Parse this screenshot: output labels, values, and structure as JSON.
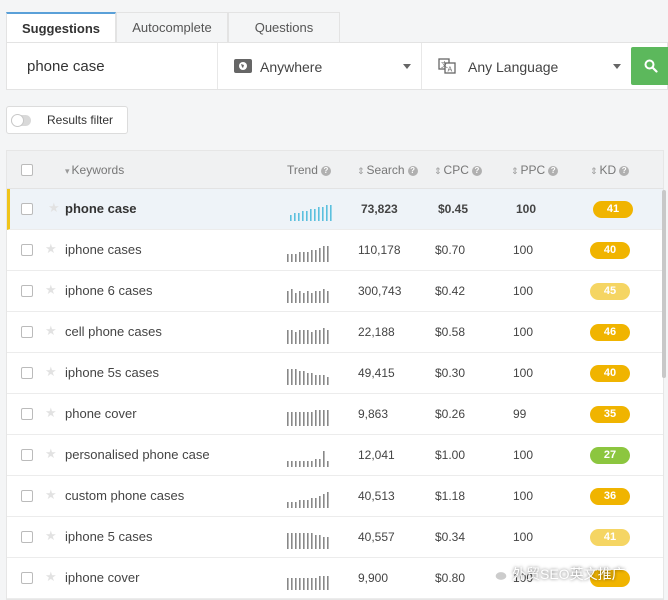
{
  "tabs": [
    {
      "label": "Suggestions",
      "active": true
    },
    {
      "label": "Autocomplete",
      "active": false
    },
    {
      "label": "Questions",
      "active": false
    }
  ],
  "search": {
    "value": "phone case",
    "location": "Anywhere",
    "language": "Any Language",
    "button_icon": "search-icon"
  },
  "filter": {
    "label": "Results filter",
    "enabled": false
  },
  "table": {
    "headers": {
      "keywords": "Keywords",
      "trend": "Trend",
      "search": "Search",
      "cpc": "CPC",
      "ppc": "PPC",
      "kd": "KD"
    },
    "rows": [
      {
        "keyword": "phone case",
        "search": "73,823",
        "cpc": "$0.45",
        "ppc": "100",
        "kd": "41",
        "kd_color": "#f0b400",
        "trend": [
          3,
          4,
          4,
          5,
          5,
          6,
          6,
          7,
          7,
          8,
          8
        ],
        "trend_color": "#5bc0de"
      },
      {
        "keyword": "iphone cases",
        "search": "110,178",
        "cpc": "$0.70",
        "ppc": "100",
        "kd": "40",
        "kd_color": "#f0b400",
        "trend": [
          4,
          4,
          4,
          5,
          5,
          5,
          6,
          6,
          7,
          8,
          8
        ],
        "trend_color": "#888888"
      },
      {
        "keyword": "iphone 6 cases",
        "search": "300,743",
        "cpc": "$0.42",
        "ppc": "100",
        "kd": "45",
        "kd_color": "#f5d563",
        "trend": [
          6,
          7,
          5,
          6,
          5,
          6,
          5,
          6,
          6,
          7,
          6
        ],
        "trend_color": "#888888"
      },
      {
        "keyword": "cell phone cases",
        "search": "22,188",
        "cpc": "$0.58",
        "ppc": "100",
        "kd": "46",
        "kd_color": "#f0b400",
        "trend": [
          7,
          7,
          6,
          7,
          7,
          7,
          6,
          7,
          7,
          8,
          7
        ],
        "trend_color": "#888888"
      },
      {
        "keyword": "iphone 5s cases",
        "search": "49,415",
        "cpc": "$0.30",
        "ppc": "100",
        "kd": "40",
        "kd_color": "#f0b400",
        "trend": [
          8,
          8,
          8,
          7,
          7,
          6,
          6,
          5,
          5,
          5,
          4
        ],
        "trend_color": "#888888"
      },
      {
        "keyword": "phone cover",
        "search": "9,863",
        "cpc": "$0.26",
        "ppc": "99",
        "kd": "35",
        "kd_color": "#f0b400",
        "trend": [
          7,
          7,
          7,
          7,
          7,
          7,
          7,
          8,
          8,
          8,
          8
        ],
        "trend_color": "#888888"
      },
      {
        "keyword": "personalised phone case",
        "search": "12,041",
        "cpc": "$1.00",
        "ppc": "100",
        "kd": "27",
        "kd_color": "#8cc63f",
        "trend": [
          3,
          3,
          3,
          3,
          3,
          3,
          3,
          4,
          4,
          8,
          3
        ],
        "trend_color": "#888888"
      },
      {
        "keyword": "custom phone cases",
        "search": "40,513",
        "cpc": "$1.18",
        "ppc": "100",
        "kd": "36",
        "kd_color": "#f0b400",
        "trend": [
          3,
          3,
          3,
          4,
          4,
          4,
          5,
          5,
          6,
          7,
          8
        ],
        "trend_color": "#888888"
      },
      {
        "keyword": "iphone 5 cases",
        "search": "40,557",
        "cpc": "$0.34",
        "ppc": "100",
        "kd": "41",
        "kd_color": "#f5d563",
        "trend": [
          8,
          8,
          8,
          8,
          8,
          8,
          8,
          7,
          7,
          6,
          6
        ],
        "trend_color": "#888888"
      },
      {
        "keyword": "iphone cover",
        "search": "9,900",
        "cpc": "$0.80",
        "ppc": "100",
        "kd": "",
        "kd_color": "#f0b400",
        "trend": [
          6,
          6,
          6,
          6,
          6,
          6,
          6,
          6,
          7,
          7,
          7
        ],
        "trend_color": "#888888"
      }
    ]
  },
  "watermark": "外贸SEO英文推广"
}
